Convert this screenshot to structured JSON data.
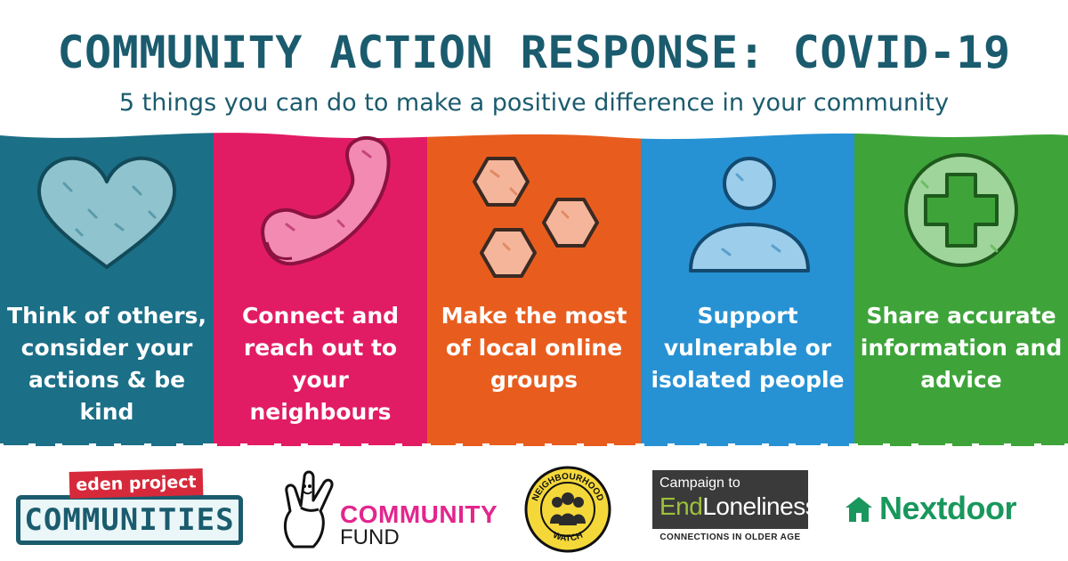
{
  "header": {
    "title": "COMMUNITY ACTION RESPONSE: COVID-19",
    "subtitle": "5 things you can do to make a positive difference in your community"
  },
  "panels": [
    {
      "text": "Think of others, consider your actions & be kind",
      "icon": "heart-icon",
      "color": "#1b6f87"
    },
    {
      "text": "Connect and reach out to your neighbours",
      "icon": "phone-icon",
      "color": "#e21c64"
    },
    {
      "text": "Make the most of local online groups",
      "icon": "hexagons-icon",
      "color": "#e85d1e"
    },
    {
      "text": "Support vulnerable or isolated people",
      "icon": "person-icon",
      "color": "#2792d3"
    },
    {
      "text": "Share accurate information and advice",
      "icon": "plus-icon",
      "color": "#3ea43a"
    }
  ],
  "logos": {
    "eden": {
      "top": "eden project",
      "bottom": "COMMUNITIES"
    },
    "lottery": {
      "top": "COMMUNITY",
      "bottom": "FUND"
    },
    "watch": {
      "top": "NEIGHBOURHOOD",
      "bottom": "WATCH"
    },
    "campaign": {
      "top": "Campaign to",
      "mid_a": "End",
      "mid_b": "Loneliness",
      "bottom": "CONNECTIONS IN OLDER AGE"
    },
    "nextdoor": {
      "name": "Nextdoor"
    }
  },
  "colors": {
    "title": "#1b5b6e",
    "lottery_pink": "#e3268d",
    "nextdoor_green": "#19975d",
    "loneliness_green": "#9dc13c"
  }
}
